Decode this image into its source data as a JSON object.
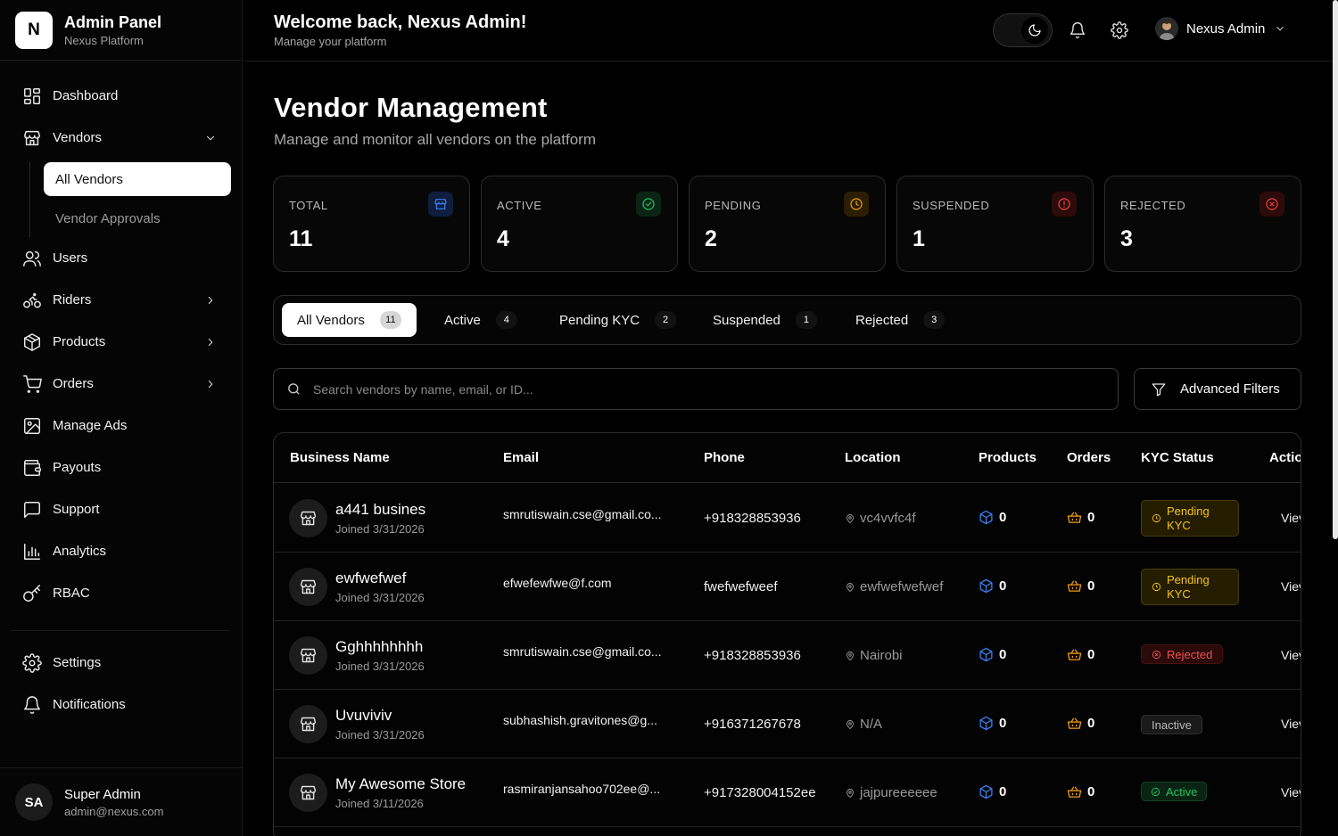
{
  "sidebar": {
    "logo_letter": "N",
    "title": "Admin Panel",
    "subtitle": "Nexus Platform",
    "nav": {
      "dashboard": "Dashboard",
      "vendors": "Vendors",
      "vendors_sub": [
        "All Vendors",
        "Vendor Approvals"
      ],
      "users": "Users",
      "riders": "Riders",
      "products": "Products",
      "orders": "Orders",
      "manage_ads": "Manage Ads",
      "payouts": "Payouts",
      "support": "Support",
      "analytics": "Analytics",
      "rbac": "RBAC",
      "settings": "Settings",
      "notifications": "Notifications"
    },
    "user": {
      "initials": "SA",
      "name": "Super Admin",
      "email": "admin@nexus.com"
    }
  },
  "header": {
    "welcome": "Welcome back, Nexus Admin!",
    "subtitle": "Manage your platform",
    "profile_name": "Nexus Admin"
  },
  "page": {
    "title": "Vendor Management",
    "subtitle": "Manage and monitor all vendors on the platform"
  },
  "stats": [
    {
      "label": "TOTAL",
      "value": "11",
      "color": "#3b82f6",
      "icon": "store-icon"
    },
    {
      "label": "ACTIVE",
      "value": "4",
      "color": "#22c55e",
      "icon": "check-circle-icon"
    },
    {
      "label": "PENDING",
      "value": "2",
      "color": "#f59e0b",
      "icon": "clock-icon"
    },
    {
      "label": "SUSPENDED",
      "value": "1",
      "color": "#ef4444",
      "icon": "alert-circle-icon"
    },
    {
      "label": "REJECTED",
      "value": "3",
      "color": "#ef4444",
      "icon": "x-circle-icon"
    }
  ],
  "tabs": [
    {
      "label": "All Vendors",
      "count": "11"
    },
    {
      "label": "Active",
      "count": "4"
    },
    {
      "label": "Pending KYC",
      "count": "2"
    },
    {
      "label": "Suspended",
      "count": "1"
    },
    {
      "label": "Rejected",
      "count": "3"
    }
  ],
  "search": {
    "placeholder": "Search vendors by name, email, or ID..."
  },
  "advanced_filters_label": "Advanced Filters",
  "table": {
    "columns": [
      "Business Name",
      "Email",
      "Phone",
      "Location",
      "Products",
      "Orders",
      "KYC Status",
      "Actio"
    ],
    "rows": [
      {
        "name": "a441 busines",
        "joined": "Joined 3/31/2026",
        "email": "smrutiswain.cse@gmail.co...",
        "phone": "+918328853936",
        "location": "vc4vvfc4f",
        "products": "0",
        "orders": "0",
        "kyc": "Pending KYC",
        "kyc_line1": "Pending",
        "kyc_line2": "KYC",
        "action": "Viev"
      },
      {
        "name": "ewfwefwef",
        "joined": "Joined 3/31/2026",
        "email": "efwefewfwe@f.com",
        "phone": "fwefwefweef",
        "location": "ewfwefwefwef",
        "products": "0",
        "orders": "0",
        "kyc": "Pending KYC",
        "kyc_line1": "Pending",
        "kyc_line2": "KYC",
        "action": "Viev"
      },
      {
        "name": "Gghhhhhhhh",
        "joined": "Joined 3/31/2026",
        "email": "smrutiswain.cse@gmail.co...",
        "phone": "+918328853936",
        "location": "Nairobi",
        "products": "0",
        "orders": "0",
        "kyc": "Rejected",
        "action": "Viev"
      },
      {
        "name": "Uvuviviv",
        "joined": "Joined 3/31/2026",
        "email": "subhashish.gravitones@g...",
        "phone": "+916371267678",
        "location": "N/A",
        "products": "0",
        "orders": "0",
        "kyc": "Inactive",
        "action": "Viev"
      },
      {
        "name": "My Awesome Store",
        "joined": "Joined 3/11/2026",
        "email": "rasmiranjansahoo702ee@...",
        "phone": "+917328004152ee",
        "location": "jajpureeeeee",
        "products": "0",
        "orders": "0",
        "kyc": "Active",
        "action": "Viev"
      }
    ]
  }
}
